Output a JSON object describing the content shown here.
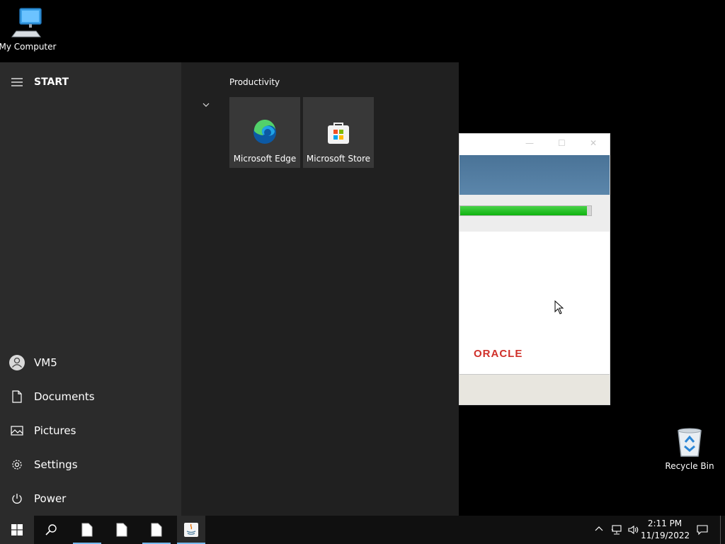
{
  "desktop": {
    "icons": [
      {
        "label": "My Computer",
        "icon": "computer-icon"
      },
      {
        "label": "Recycle Bin",
        "icon": "recycle-bin-icon"
      }
    ]
  },
  "oracle_window": {
    "brand": "ORACLE",
    "progress_percent": 97,
    "colors": {
      "banner": "#4a7397",
      "progress": "#10b310",
      "brand": "#d0302a"
    }
  },
  "start_menu": {
    "header": "START",
    "left_items": [
      {
        "label": "VM5",
        "icon": "user-avatar-icon"
      },
      {
        "label": "Documents",
        "icon": "document-icon"
      },
      {
        "label": "Pictures",
        "icon": "pictures-icon"
      },
      {
        "label": "Settings",
        "icon": "gear-icon"
      },
      {
        "label": "Power",
        "icon": "power-icon"
      }
    ],
    "group": {
      "title": "Productivity",
      "tiles": [
        {
          "label": "Microsoft Edge",
          "icon": "edge-icon"
        },
        {
          "label": "Microsoft Store",
          "icon": "store-icon"
        }
      ]
    }
  },
  "taskbar": {
    "pinned": [
      {
        "icon": "windows-start-icon"
      },
      {
        "icon": "search-icon"
      },
      {
        "icon": "blank-file-icon"
      },
      {
        "icon": "blank-file-icon"
      },
      {
        "icon": "blank-file-icon"
      },
      {
        "icon": "java-icon"
      }
    ],
    "tray": {
      "time": "2:11 PM",
      "date": "11/19/2022",
      "icons": [
        "chevron-up-icon",
        "network-icon",
        "volume-icon",
        "notification-icon"
      ]
    }
  }
}
